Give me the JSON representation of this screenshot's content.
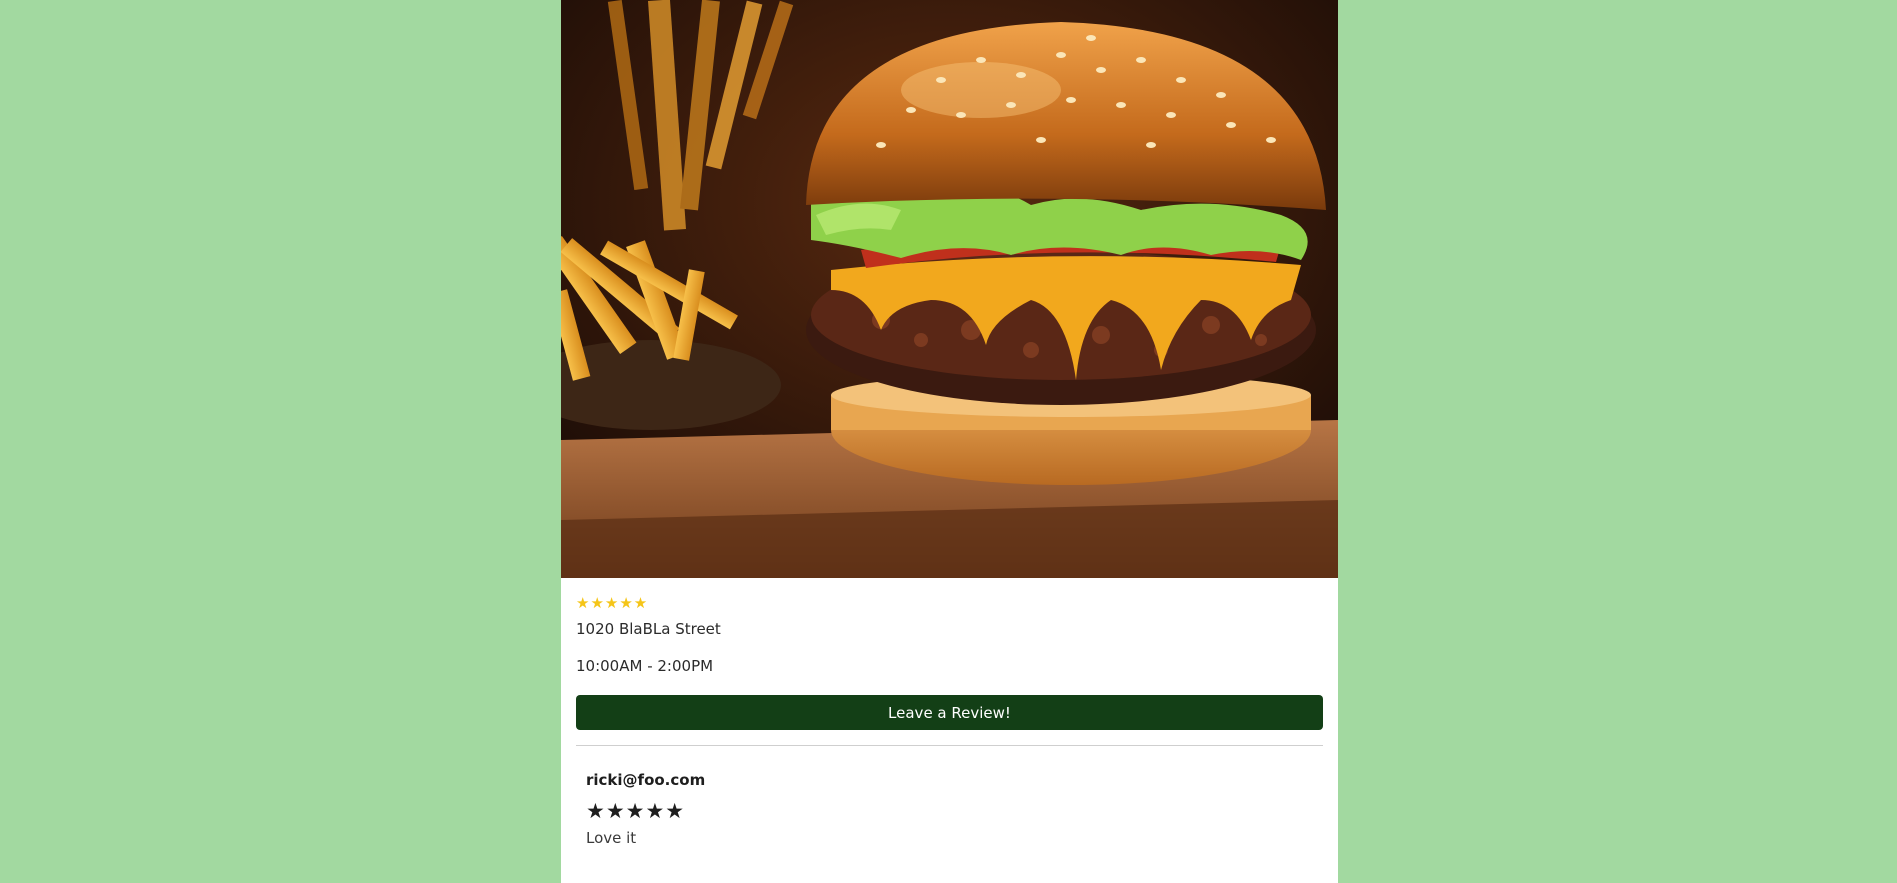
{
  "restaurant": {
    "image_alt": "Burger with fries",
    "rating_stars": "★★★★★",
    "address": "1020 BlaBLa Street",
    "hours": "10:00AM - 2:00PM"
  },
  "actions": {
    "leave_review_label": "Leave a Review!"
  },
  "reviews": [
    {
      "author": "ricki@foo.com",
      "stars": "★★★★★",
      "text": "Love it"
    }
  ],
  "colors": {
    "page_background": "#a2d9a0",
    "card_background": "#ffffff",
    "button_background": "#133f16",
    "star_gold": "#f5c518"
  }
}
